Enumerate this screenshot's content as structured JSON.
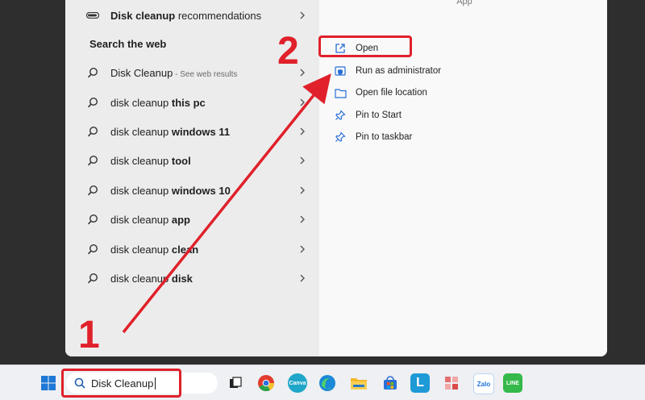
{
  "panel": {
    "app_label": "App",
    "top_result": {
      "prefix": "Disk cleanup",
      "suffix": " recommendations"
    },
    "section_title": "Search the web",
    "web_results": [
      {
        "prefix": "Disk Cleanup",
        "bold": "",
        "sub": " - See web results"
      },
      {
        "prefix": "disk cleanup ",
        "bold": "this pc",
        "sub": ""
      },
      {
        "prefix": "disk cleanup ",
        "bold": "windows 11",
        "sub": ""
      },
      {
        "prefix": "disk cleanup ",
        "bold": "tool",
        "sub": ""
      },
      {
        "prefix": "disk cleanup ",
        "bold": "windows 10",
        "sub": ""
      },
      {
        "prefix": "disk cleanup ",
        "bold": "app",
        "sub": ""
      },
      {
        "prefix": "disk cleanup ",
        "bold": "clean",
        "sub": ""
      },
      {
        "prefix": "disk cleanup ",
        "bold": "disk",
        "sub": ""
      }
    ],
    "actions": [
      {
        "label": "Open",
        "icon": "open-external-icon"
      },
      {
        "label": "Run as administrator",
        "icon": "shield-admin-icon"
      },
      {
        "label": "Open file location",
        "icon": "folder-icon"
      },
      {
        "label": "Pin to Start",
        "icon": "pin-icon"
      },
      {
        "label": "Pin to taskbar",
        "icon": "pin-icon"
      }
    ]
  },
  "taskbar": {
    "search_value": "Disk Cleanup",
    "apps": [
      {
        "name": "windows-start-icon"
      },
      {
        "name": "task-view-icon"
      },
      {
        "name": "chrome-icon"
      },
      {
        "name": "canva-icon",
        "label": "Canva"
      },
      {
        "name": "edge-icon"
      },
      {
        "name": "file-explorer-icon"
      },
      {
        "name": "microsoft-store-icon"
      },
      {
        "name": "l-app-icon",
        "label": "L"
      },
      {
        "name": "grid-app-icon"
      },
      {
        "name": "zalo-icon",
        "label": "Zalo"
      },
      {
        "name": "line-icon",
        "label": "LINE"
      }
    ]
  },
  "annotations": {
    "step1": "1",
    "step2": "2",
    "accent": "#e0202a"
  }
}
